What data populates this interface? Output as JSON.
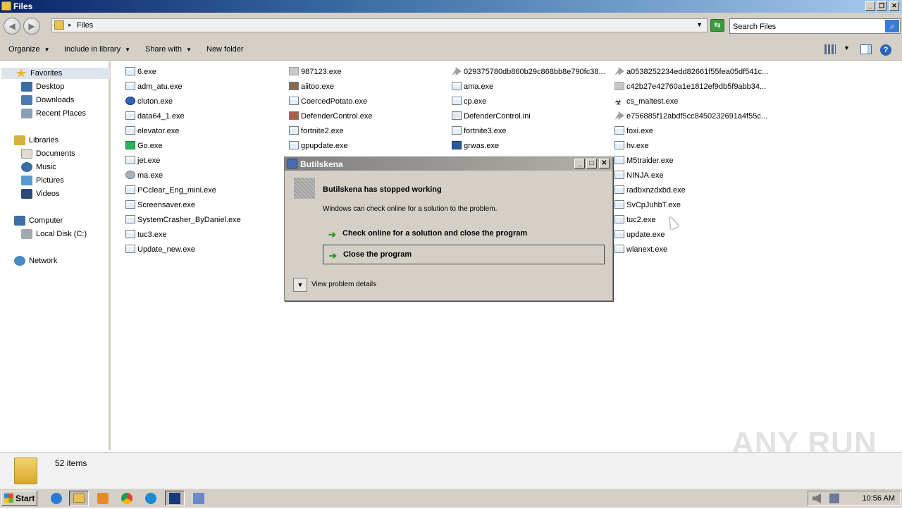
{
  "window": {
    "title": "Files"
  },
  "address": {
    "path": "Files",
    "search_placeholder": "Search Files"
  },
  "toolbar": {
    "organize": "Organize",
    "include_in_library": "Include in library",
    "share_with": "Share with",
    "new_folder": "New folder"
  },
  "navpane": {
    "favorites": "Favorites",
    "desktop": "Desktop",
    "downloads": "Downloads",
    "recent_places": "Recent Places",
    "libraries": "Libraries",
    "documents": "Documents",
    "music": "Music",
    "pictures": "Pictures",
    "videos": "Videos",
    "computer": "Computer",
    "local_disk": "Local Disk (C:)",
    "network": "Network"
  },
  "files": {
    "col1": [
      "6.exe",
      "adm_atu.exe",
      "cluton.exe",
      "data64_1.exe",
      "elevator.exe",
      "Go.exe",
      "jet.exe",
      "ma.exe",
      "PCclear_Eng_mini.exe",
      "Screensaver.exe",
      "SystemCrasher_ByDaniel.exe",
      "tuc3.exe",
      "Update_new.exe"
    ],
    "col2": [
      "987123.exe",
      "aiitoo.exe",
      "CoercedPotato.exe",
      "DefenderControl.exe",
      "fortnite2.exe",
      "gpupdate.exe"
    ],
    "col3": [
      "029375780db860b29c868bb8e790fc38...",
      "ama.exe",
      "cp.exe",
      "DefenderControl.ini",
      "fortnite3.exe",
      "grwas.exe"
    ],
    "col4": [
      "a0538252234edd82661f55fea05df541c...",
      "c42b27e42760a1e1812ef9db5f9abb34...",
      "cs_maltest.exe",
      "e756885f12abdf5cc8450232691a4f55c...",
      "foxi.exe",
      "hv.exe",
      "M5traider.exe",
      "NINJA.exe",
      "radbxnzdxbd.exe",
      "SvCpJuhbT.exe",
      "tuc2.exe",
      "update.exe",
      "wlanext.exe"
    ]
  },
  "status": {
    "items": "52 items"
  },
  "watermark": "ANY RUN",
  "dialog": {
    "title": "Butilskena",
    "heading": "Butilskena has stopped working",
    "message": "Windows can check online for a solution to the problem.",
    "option1": "Check online for a solution and close the program",
    "option2": "Close the program",
    "details": "View problem details"
  },
  "taskbar": {
    "start": "Start",
    "clock": "10:56 AM"
  }
}
